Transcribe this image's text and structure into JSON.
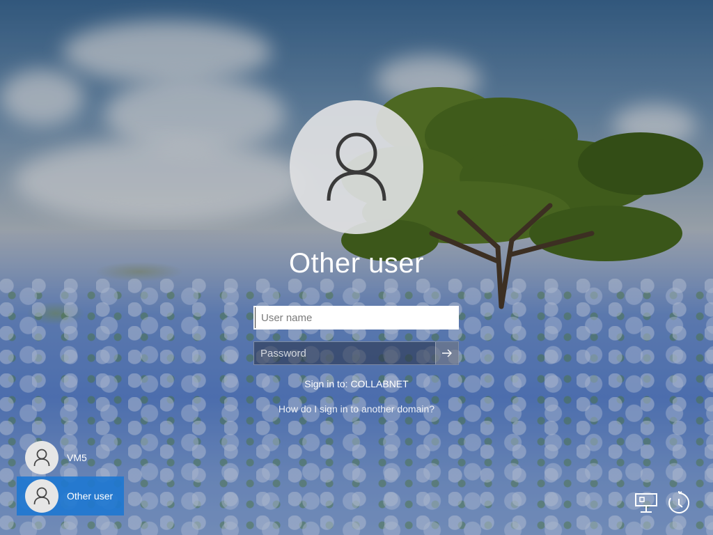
{
  "screen": {
    "user_display_name": "Other user",
    "username_placeholder": "User name",
    "password_placeholder": "Password",
    "sign_in_to": "Sign in to: COLLABNET",
    "domain_help_link": "How do I sign in to another domain?"
  },
  "user_list": [
    {
      "name": "VM5",
      "selected": false
    },
    {
      "name": "Other user",
      "selected": true
    }
  ],
  "corner_icons": [
    "network-icon",
    "ease-of-access-icon"
  ],
  "colors": {
    "selected_tile": "#1e78d2",
    "avatar_bg": "#dee0e2"
  }
}
